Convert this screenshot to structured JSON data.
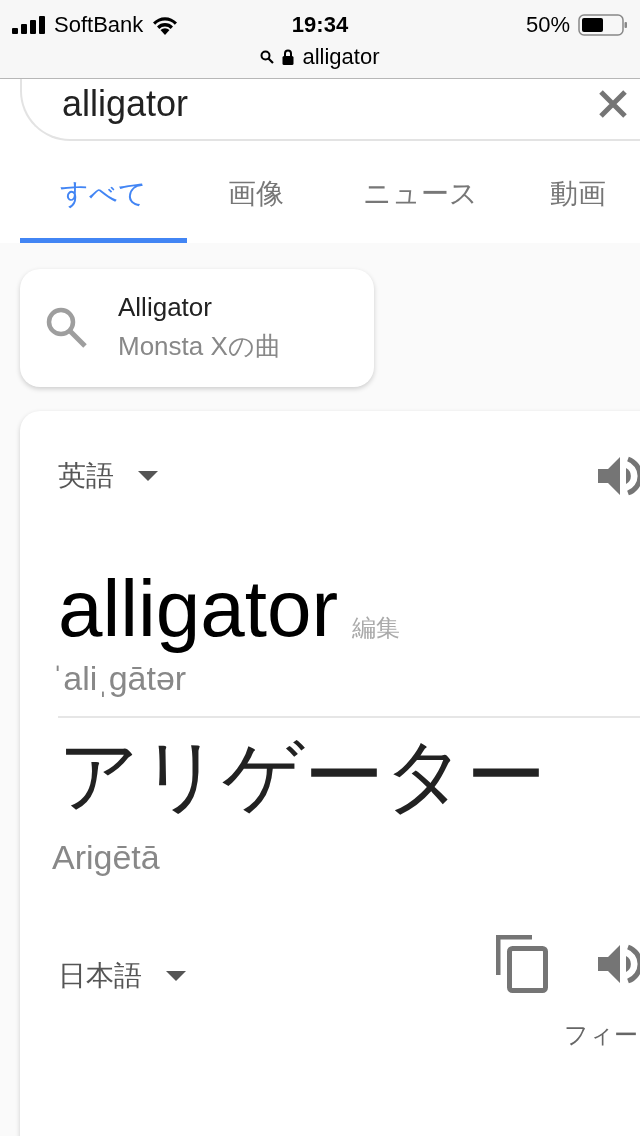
{
  "status_bar": {
    "carrier": "SoftBank",
    "time": "19:34",
    "battery": "50%"
  },
  "address_bar": {
    "url": "alligator"
  },
  "search": {
    "value": "alligator"
  },
  "tabs": [
    {
      "label": "すべて",
      "selected": true
    },
    {
      "label": "画像",
      "selected": false
    },
    {
      "label": "ニュース",
      "selected": false
    },
    {
      "label": "動画",
      "selected": false
    }
  ],
  "suggestion": {
    "title": "Alligator",
    "subtitle": "Monsta Xの曲"
  },
  "translation": {
    "source_language": "英語",
    "source_word": "alligator",
    "edit_label": "編集",
    "phonetic": "ˈaliˌgātər",
    "target_word": "アリゲーター",
    "romanization": "Arigētā",
    "target_language": "日本語",
    "feedback_label": "フィー"
  }
}
